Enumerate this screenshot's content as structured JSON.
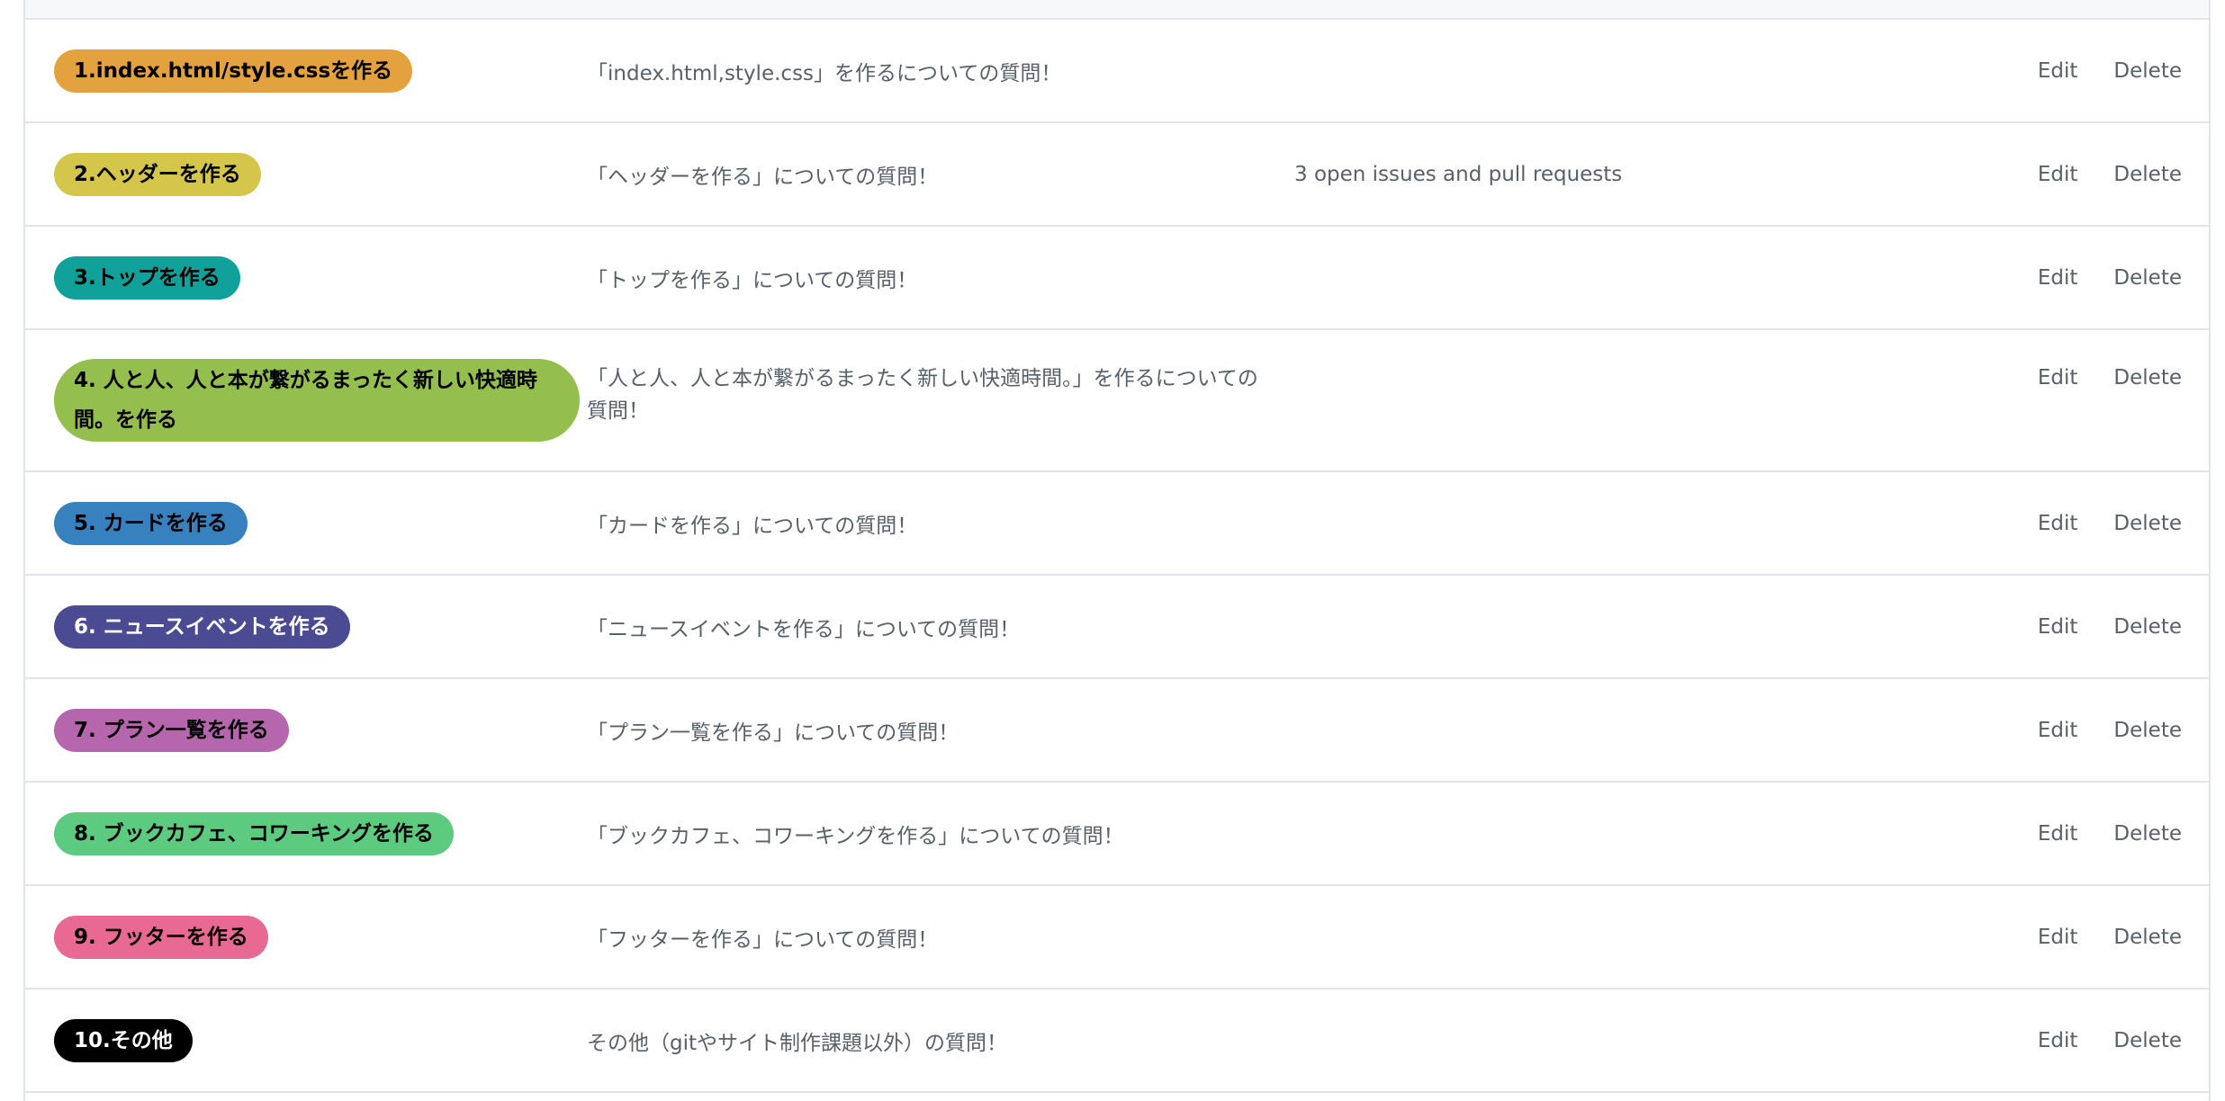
{
  "labels": [
    {
      "name": "1.index.html/style.cssを作る",
      "color": "#e4a23e",
      "text_color": "#000000",
      "description": "「index.html,style.css」を作るについての質問！",
      "issues": ""
    },
    {
      "name": "2.ヘッダーを作る",
      "color": "#d4c64b",
      "text_color": "#000000",
      "description": "「ヘッダーを作る」についての質問！",
      "issues": "3 open issues and pull requests"
    },
    {
      "name": "3.トップを作る",
      "color": "#10a19a",
      "text_color": "#000000",
      "description": "「トップを作る」についての質問！",
      "issues": ""
    },
    {
      "name": "4. 人と人、人と本が繋がるまったく新しい快適時間。を作る",
      "color": "#94bf4f",
      "text_color": "#000000",
      "description": "「人と人、人と本が繋がるまったく新しい快適時間。」を作るについての質問！",
      "issues": ""
    },
    {
      "name": "5. カードを作る",
      "color": "#3781be",
      "text_color": "#000000",
      "description": "「カードを作る」についての質問！",
      "issues": ""
    },
    {
      "name": "6. ニュースイベントを作る",
      "color": "#4b4b94",
      "text_color": "#ffffff",
      "description": "「ニュースイベントを作る」についての質問！",
      "issues": ""
    },
    {
      "name": "7. プラン一覧を作る",
      "color": "#b666ad",
      "text_color": "#000000",
      "description": "「プラン一覧を作る」についての質問！",
      "issues": ""
    },
    {
      "name": "8. ブックカフェ、コワーキングを作る",
      "color": "#5ccb80",
      "text_color": "#000000",
      "description": "「ブックカフェ、コワーキングを作る」についての質問！",
      "issues": ""
    },
    {
      "name": "9. フッターを作る",
      "color": "#e86a93",
      "text_color": "#000000",
      "description": "「フッターを作る」についての質問！",
      "issues": ""
    },
    {
      "name": "10.その他",
      "color": "#000000",
      "text_color": "#ffffff",
      "description": "その他（gitやサイト制作課題以外）の質問！",
      "issues": ""
    }
  ],
  "actions": {
    "edit_label": "Edit",
    "delete_label": "Delete"
  }
}
